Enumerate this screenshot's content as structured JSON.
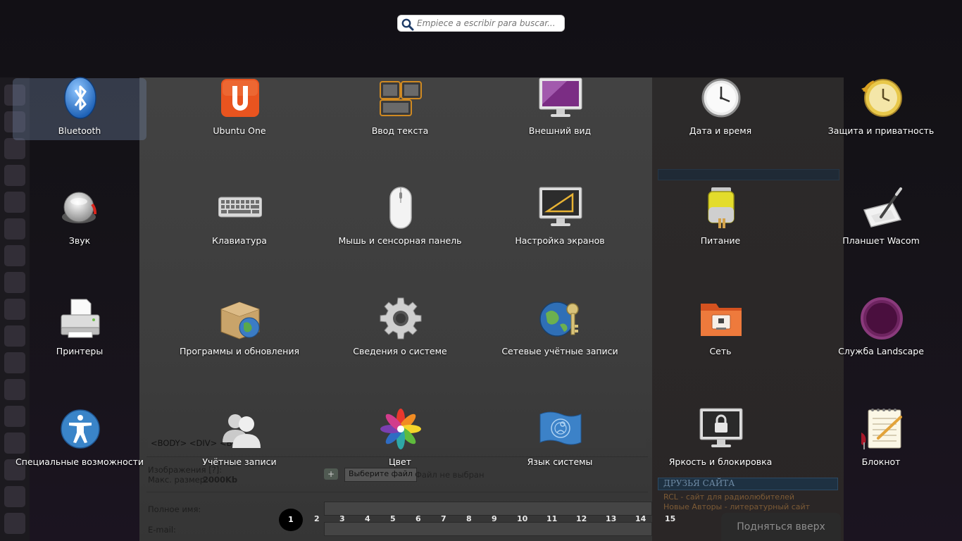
{
  "search": {
    "placeholder": "Empiece a escribir para buscar..."
  },
  "items": [
    {
      "label": "Bluetooth",
      "icon": "bluetooth-icon"
    },
    {
      "label": "Ubuntu One",
      "icon": "ubuntu-one-icon"
    },
    {
      "label": "Ввод текста",
      "icon": "text-entry-icon"
    },
    {
      "label": "Внешний вид",
      "icon": "appearance-icon"
    },
    {
      "label": "Дата и время",
      "icon": "clock-icon"
    },
    {
      "label": "Защита и приватность",
      "icon": "privacy-icon"
    },
    {
      "label": "Звук",
      "icon": "sound-icon"
    },
    {
      "label": "Клавиатура",
      "icon": "keyboard-icon"
    },
    {
      "label": "Мышь и сенсорная панель",
      "icon": "mouse-icon"
    },
    {
      "label": "Настройка экранов",
      "icon": "displays-icon"
    },
    {
      "label": "Питание",
      "icon": "battery-icon"
    },
    {
      "label": "Планшет Wacom",
      "icon": "wacom-tablet-icon"
    },
    {
      "label": "Принтеры",
      "icon": "printer-icon"
    },
    {
      "label": "Программы и обновления",
      "icon": "software-updates-icon"
    },
    {
      "label": "Сведения о системе",
      "icon": "gear-icon"
    },
    {
      "label": "Сетевые учётные записи",
      "icon": "online-accounts-icon"
    },
    {
      "label": "Сеть",
      "icon": "network-folder-icon"
    },
    {
      "label": "Служба Landscape",
      "icon": "landscape-icon"
    },
    {
      "label": "Специальные возможности",
      "icon": "accessibility-icon"
    },
    {
      "label": "Учётные записи",
      "icon": "user-accounts-icon"
    },
    {
      "label": "Цвет",
      "icon": "color-icon"
    },
    {
      "label": "Язык системы",
      "icon": "language-icon"
    },
    {
      "label": "Яркость и блокировка",
      "icon": "brightness-lock-icon"
    },
    {
      "label": "Блокнот",
      "icon": "notepad-icon"
    }
  ],
  "background": {
    "tag_path": "<BODY>  <DIV>  <BR>",
    "images_label": "Изображения [?]:",
    "max_size_label": "Макс. размер -",
    "max_size_value": "2000Kb",
    "choose_file_button": "Выберите файл",
    "no_file_text": "Файл не выбран",
    "full_name_label": "Полное имя:",
    "email_label": "E-mail:",
    "friends_heading": "ДРУЗЬЯ САЙТА",
    "friends_links": [
      "RCL - сайт для радиолюбителей",
      "Новые Авторы - литературный сайт"
    ],
    "pager": [
      "1",
      "2",
      "3",
      "4",
      "5",
      "6",
      "7",
      "8",
      "9",
      "10",
      "11",
      "12",
      "13",
      "14",
      "15"
    ],
    "scroll_top": "Подняться вверх"
  }
}
